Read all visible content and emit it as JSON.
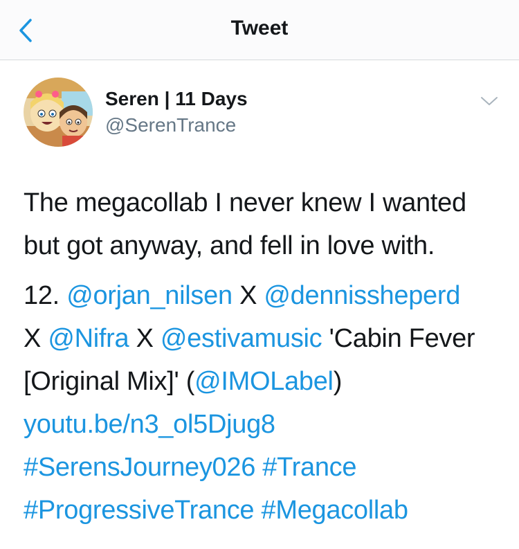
{
  "header": {
    "title": "Tweet"
  },
  "icons": {
    "back": "chevron-left-icon",
    "caret": "chevron-down-icon"
  },
  "colors": {
    "link": "#1b95e0",
    "text": "#14171a",
    "secondary": "#657786",
    "header_bg": "#fbfbfc",
    "divider": "#d6d9dc"
  },
  "tweet": {
    "author_name": "Seren | 11 Days",
    "author_handle": "@SerenTrance",
    "body_line1": "The megacollab I never knew I wanted",
    "body_line2": "but got anyway, and fell in love with.",
    "track_number": "12.",
    "mention1": "@orjan_nilsen",
    "sep1": "X",
    "mention2": "@dennissheperd",
    "sep2": "X",
    "mention3": "@Nifra",
    "sep3": "X",
    "mention4": "@estivamusic",
    "title_part1": "'Cabin Fever",
    "title_part2": "[Original Mix]' (",
    "mention5": "@IMOLabel",
    "close_paren": ")",
    "url": "youtu.be/n3_ol5Djug8",
    "hashtag1": "#SerensJourney026",
    "hashtag2": "#Trance",
    "hashtag3": "#ProgressiveTrance",
    "hashtag4": "#Megacollab"
  }
}
